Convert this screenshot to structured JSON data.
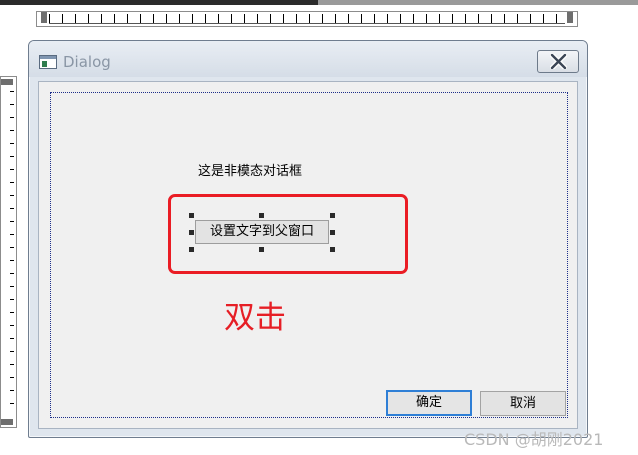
{
  "dialog": {
    "title": "Dialog",
    "static_label": "这是非模态对话框",
    "set_text_button": "设置文字到父窗口",
    "annotation": "双击",
    "ok_button": "确定",
    "cancel_button": "取消"
  },
  "watermark": "CSDN @胡刚2021",
  "colors": {
    "annotation_red": "#ea1c24",
    "default_button_border": "#2f7fd6",
    "client_background": "#f0f0f0"
  },
  "icons": {
    "title": "dialog-window-icon",
    "close": "close-x-icon"
  }
}
